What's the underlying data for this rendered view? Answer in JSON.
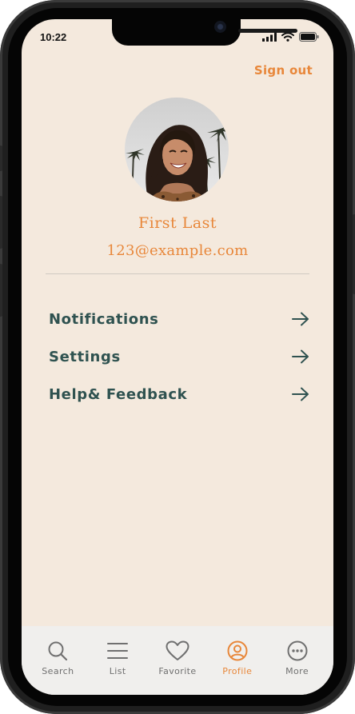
{
  "status_bar": {
    "time": "10:22"
  },
  "header": {
    "sign_out_label": "Sign out"
  },
  "profile": {
    "name": "First Last",
    "email": "123@example.com"
  },
  "menu": {
    "items": [
      {
        "label": "Notifications",
        "icon": "arrow-right-icon"
      },
      {
        "label": "Settings",
        "icon": "arrow-right-icon"
      },
      {
        "label": "Help& Feedback",
        "icon": "arrow-right-icon"
      }
    ]
  },
  "tab_bar": {
    "active": "Profile",
    "items": [
      {
        "label": "Search",
        "icon": "search-icon"
      },
      {
        "label": "List",
        "icon": "list-icon"
      },
      {
        "label": "Favorite",
        "icon": "heart-icon"
      },
      {
        "label": "Profile",
        "icon": "profile-icon"
      },
      {
        "label": "More",
        "icon": "more-icon"
      }
    ]
  },
  "colors": {
    "background": "#f4e9dd",
    "accent": "#e8873a",
    "menu_text": "#2f5250",
    "tab_bar_bg": "#f0efed",
    "tab_inactive": "#707070"
  }
}
